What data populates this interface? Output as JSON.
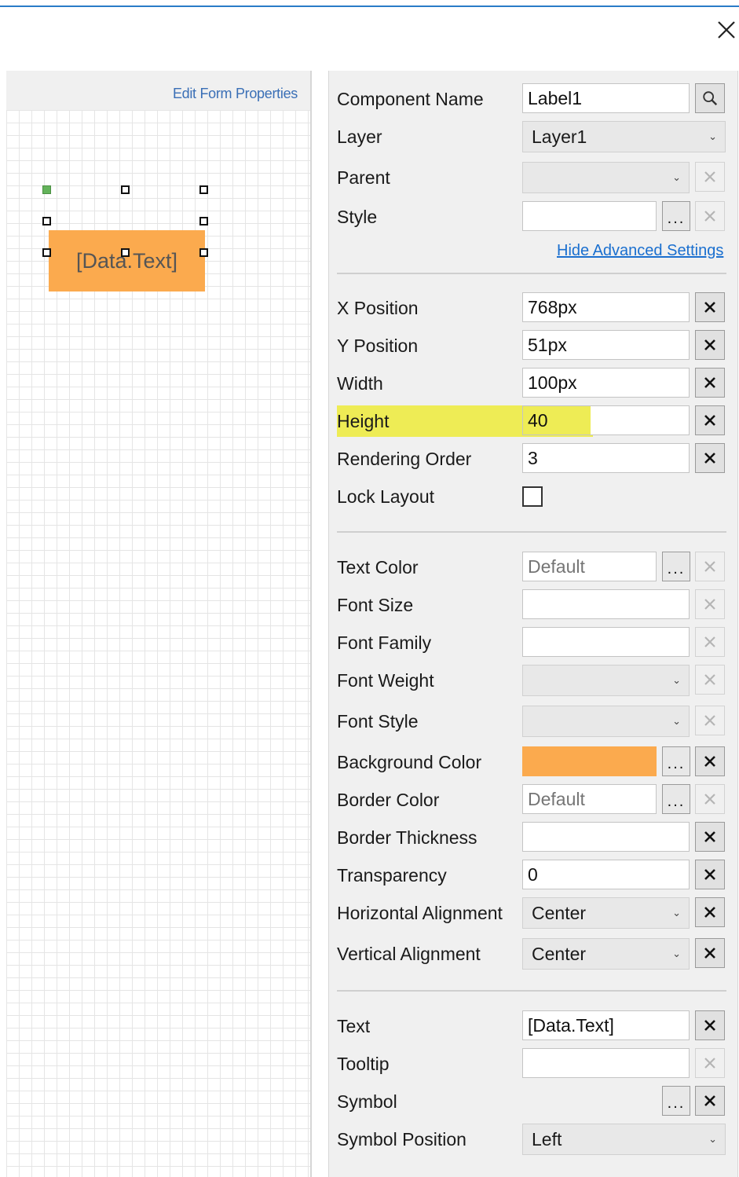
{
  "window": {
    "close_icon": "close-icon"
  },
  "designer": {
    "edit_form_properties": "Edit Form Properties",
    "component_text": "[Data.Text]",
    "component_color": "#fbaa4e"
  },
  "props": {
    "component_name": {
      "label": "Component Name",
      "value": "Label1"
    },
    "layer": {
      "label": "Layer",
      "value": "Layer1"
    },
    "parent": {
      "label": "Parent",
      "value": ""
    },
    "style": {
      "label": "Style",
      "value": ""
    },
    "hide_advanced": "Hide Advanced Settings",
    "x_position": {
      "label": "X Position",
      "value": "768px"
    },
    "y_position": {
      "label": "Y Position",
      "value": "51px"
    },
    "width": {
      "label": "Width",
      "value": "100px"
    },
    "height": {
      "label": "Height",
      "value": "40"
    },
    "rendering_order": {
      "label": "Rendering Order",
      "value": "3"
    },
    "lock_layout": {
      "label": "Lock Layout",
      "checked": false
    },
    "text_color": {
      "label": "Text Color",
      "placeholder": "Default"
    },
    "font_size": {
      "label": "Font Size",
      "value": ""
    },
    "font_family": {
      "label": "Font Family",
      "value": ""
    },
    "font_weight": {
      "label": "Font Weight",
      "value": ""
    },
    "font_style": {
      "label": "Font Style",
      "value": ""
    },
    "background_color": {
      "label": "Background Color",
      "color": "#fbaa4e"
    },
    "border_color": {
      "label": "Border Color",
      "placeholder": "Default"
    },
    "border_thickness": {
      "label": "Border Thickness",
      "value": ""
    },
    "transparency": {
      "label": "Transparency",
      "value": "0"
    },
    "horizontal_alignment": {
      "label": "Horizontal Alignment",
      "value": "Center"
    },
    "vertical_alignment": {
      "label": "Vertical Alignment",
      "value": "Center"
    },
    "text": {
      "label": "Text",
      "value": "[Data.Text]"
    },
    "tooltip": {
      "label": "Tooltip",
      "value": ""
    },
    "symbol": {
      "label": "Symbol"
    },
    "symbol_position": {
      "label": "Symbol Position",
      "value": "Left"
    },
    "dots_label": "...",
    "highlight_color": "#eeec55"
  }
}
